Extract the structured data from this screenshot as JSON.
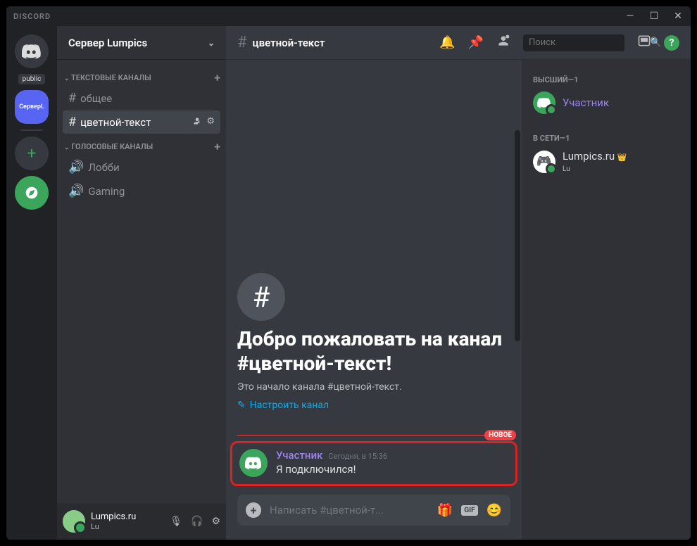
{
  "app": {
    "title": "DISCORD"
  },
  "serverCol": {
    "folder": "public",
    "selectedAbbrev": "СерверL"
  },
  "server": {
    "name": "Сервер Lumpics"
  },
  "categories": {
    "text": {
      "label": "ТЕКСТОВЫЕ КАНАЛЫ"
    },
    "voice": {
      "label": "ГОЛОСОВЫЕ КАНАЛЫ"
    }
  },
  "channels": {
    "text": [
      {
        "name": "общее"
      },
      {
        "name": "цветной-текст"
      }
    ],
    "voice": [
      {
        "name": "Лобби"
      },
      {
        "name": "Gaming"
      }
    ]
  },
  "user": {
    "name": "Lumpics.ru",
    "status": "Lu"
  },
  "chatHeader": {
    "channel": "цветной-текст",
    "searchPlaceholder": "Поиск"
  },
  "welcome": {
    "title": "Добро пожаловать на канал #цветной-текст!",
    "subtitle": "Это начало канала #цветной-текст.",
    "configure": "Настроить канал"
  },
  "divider": {
    "new": "НОВОЕ"
  },
  "message": {
    "author": "Участник",
    "time": "Сегодня, в 15:36",
    "text": "Я подключился!"
  },
  "compose": {
    "placeholder": "Написать #цветной-т..."
  },
  "members": {
    "groups": {
      "top": "ВЫСШИЙ—1",
      "online": "В СЕТИ—1"
    },
    "list": {
      "top": {
        "name": "Участник"
      },
      "online": {
        "name": "Lumpics.ru",
        "activity": "Lu"
      }
    }
  }
}
